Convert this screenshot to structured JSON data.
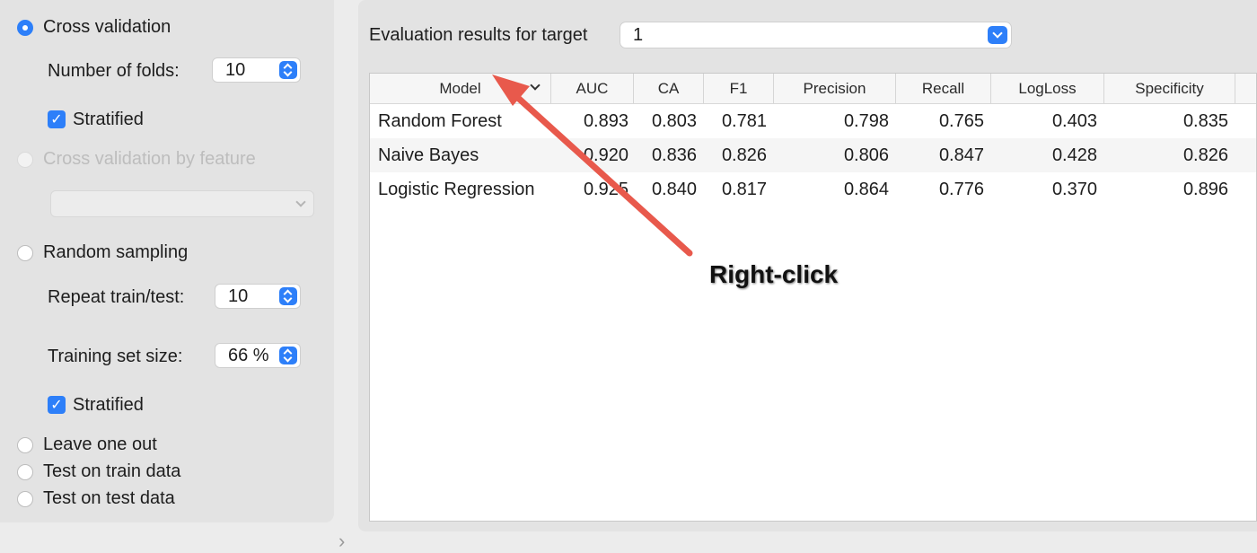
{
  "sampling": {
    "cross_validation": {
      "label": "Cross validation",
      "selected": true
    },
    "folds_label": "Number of folds:",
    "folds_value": "10",
    "stratified_1": {
      "label": "Stratified",
      "checked": true
    },
    "cv_by_feature": {
      "label": "Cross validation by feature",
      "enabled": false
    },
    "random_sampling": {
      "label": "Random sampling",
      "selected": false
    },
    "repeat_label": "Repeat train/test:",
    "repeat_value": "10",
    "train_size_label": "Training set size:",
    "train_size_value": "66 %",
    "stratified_2": {
      "label": "Stratified",
      "checked": true
    },
    "leave_one_out": {
      "label": "Leave one out",
      "selected": false
    },
    "test_on_train": {
      "label": "Test on train data",
      "selected": false
    },
    "test_on_test": {
      "label": "Test on test data",
      "selected": false
    }
  },
  "evaluation": {
    "target_label": "Evaluation results for target",
    "target_value": "1"
  },
  "table": {
    "columns": [
      "Model",
      "AUC",
      "CA",
      "F1",
      "Precision",
      "Recall",
      "LogLoss",
      "Specificity"
    ],
    "rows": [
      [
        "Random Forest",
        "0.893",
        "0.803",
        "0.781",
        "0.798",
        "0.765",
        "0.403",
        "0.835"
      ],
      [
        "Naive Bayes",
        "0.920",
        "0.836",
        "0.826",
        "0.806",
        "0.847",
        "0.428",
        "0.826"
      ],
      [
        "Logistic Regression",
        "0.925",
        "0.840",
        "0.817",
        "0.864",
        "0.776",
        "0.370",
        "0.896"
      ]
    ]
  },
  "annotation": {
    "text": "Right-click",
    "arrow_color": "#e8594c"
  },
  "colors": {
    "accent": "#2d7ff9",
    "panel": "#e3e3e3"
  },
  "icons": {
    "splitter": "chevron-right-icon",
    "sort": "chevron-down-icon"
  }
}
